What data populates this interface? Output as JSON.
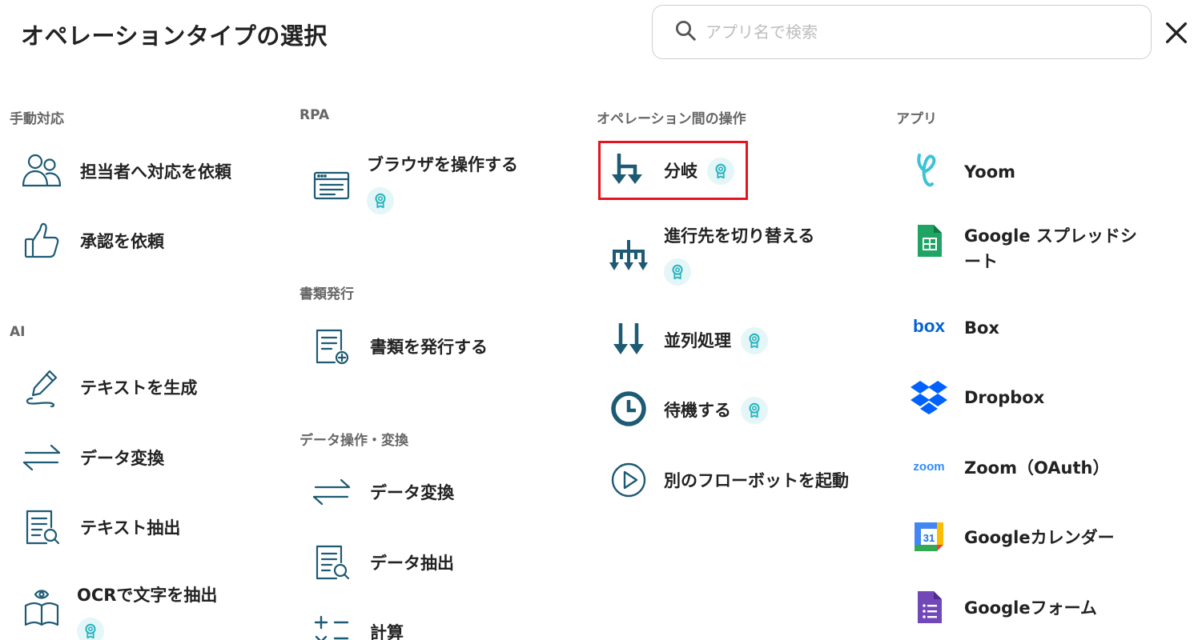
{
  "header": {
    "title": "オペレーションタイプの選択",
    "search_placeholder": "アプリ名で検索",
    "search_value": ""
  },
  "sections": {
    "manual": {
      "title": "手動対応",
      "items": [
        {
          "label": "担当者へ対応を依頼",
          "icon": "people-icon",
          "badge": false
        },
        {
          "label": "承認を依頼",
          "icon": "thumbs-up-icon",
          "badge": false
        }
      ]
    },
    "ai": {
      "title": "AI",
      "items": [
        {
          "label": "テキストを生成",
          "icon": "pen-icon",
          "badge": false
        },
        {
          "label": "データ変換",
          "icon": "arrows-swap-icon",
          "badge": false
        },
        {
          "label": "テキスト抽出",
          "icon": "document-search-icon",
          "badge": false
        },
        {
          "label": "OCRで文字を抽出",
          "icon": "book-eye-icon",
          "badge": true
        }
      ]
    },
    "rpa": {
      "title": "RPA",
      "items": [
        {
          "label": "ブラウザを操作する",
          "icon": "browser-icon",
          "badge": true
        }
      ]
    },
    "documents": {
      "title": "書類発行",
      "items": [
        {
          "label": "書類を発行する",
          "icon": "document-add-icon",
          "badge": false
        }
      ]
    },
    "data_ops": {
      "title": "データ操作・変換",
      "items": [
        {
          "label": "データ変換",
          "icon": "arrows-swap-icon",
          "badge": false
        },
        {
          "label": "データ抽出",
          "icon": "document-search-icon",
          "badge": false
        },
        {
          "label": "計算",
          "icon": "calculator-icon",
          "badge": false
        }
      ]
    },
    "between_ops": {
      "title": "オペレーション間の操作",
      "items": [
        {
          "label": "分岐",
          "icon": "branch-icon",
          "badge": true,
          "highlighted": true
        },
        {
          "label": "進行先を切り替える",
          "icon": "switch-route-icon",
          "badge": true
        },
        {
          "label": "並列処理",
          "icon": "parallel-icon",
          "badge": true
        },
        {
          "label": "待機する",
          "icon": "clock-icon",
          "badge": true
        },
        {
          "label": "別のフローボットを起動",
          "icon": "play-circle-icon",
          "badge": false
        }
      ]
    },
    "apps": {
      "title": "アプリ",
      "items": [
        {
          "label": "Yoom",
          "icon": "yoom-logo-icon"
        },
        {
          "label": "Google スプレッドシート",
          "icon": "google-sheets-icon"
        },
        {
          "label": "Box",
          "icon": "box-logo-icon"
        },
        {
          "label": "Dropbox",
          "icon": "dropbox-logo-icon"
        },
        {
          "label": "Zoom（OAuth）",
          "icon": "zoom-logo-icon"
        },
        {
          "label": "Googleカレンダー",
          "icon": "google-calendar-icon"
        },
        {
          "label": "Googleフォーム",
          "icon": "google-forms-icon"
        }
      ]
    }
  },
  "colors": {
    "icon_teal": "#1d5a73",
    "badge_bg": "#e4f6f7",
    "badge_fg": "#26b3bd",
    "highlight": "#e5141f",
    "section_title": "#666666"
  },
  "badge_icon": "premium-ribbon-icon",
  "close_icon": "close-icon"
}
